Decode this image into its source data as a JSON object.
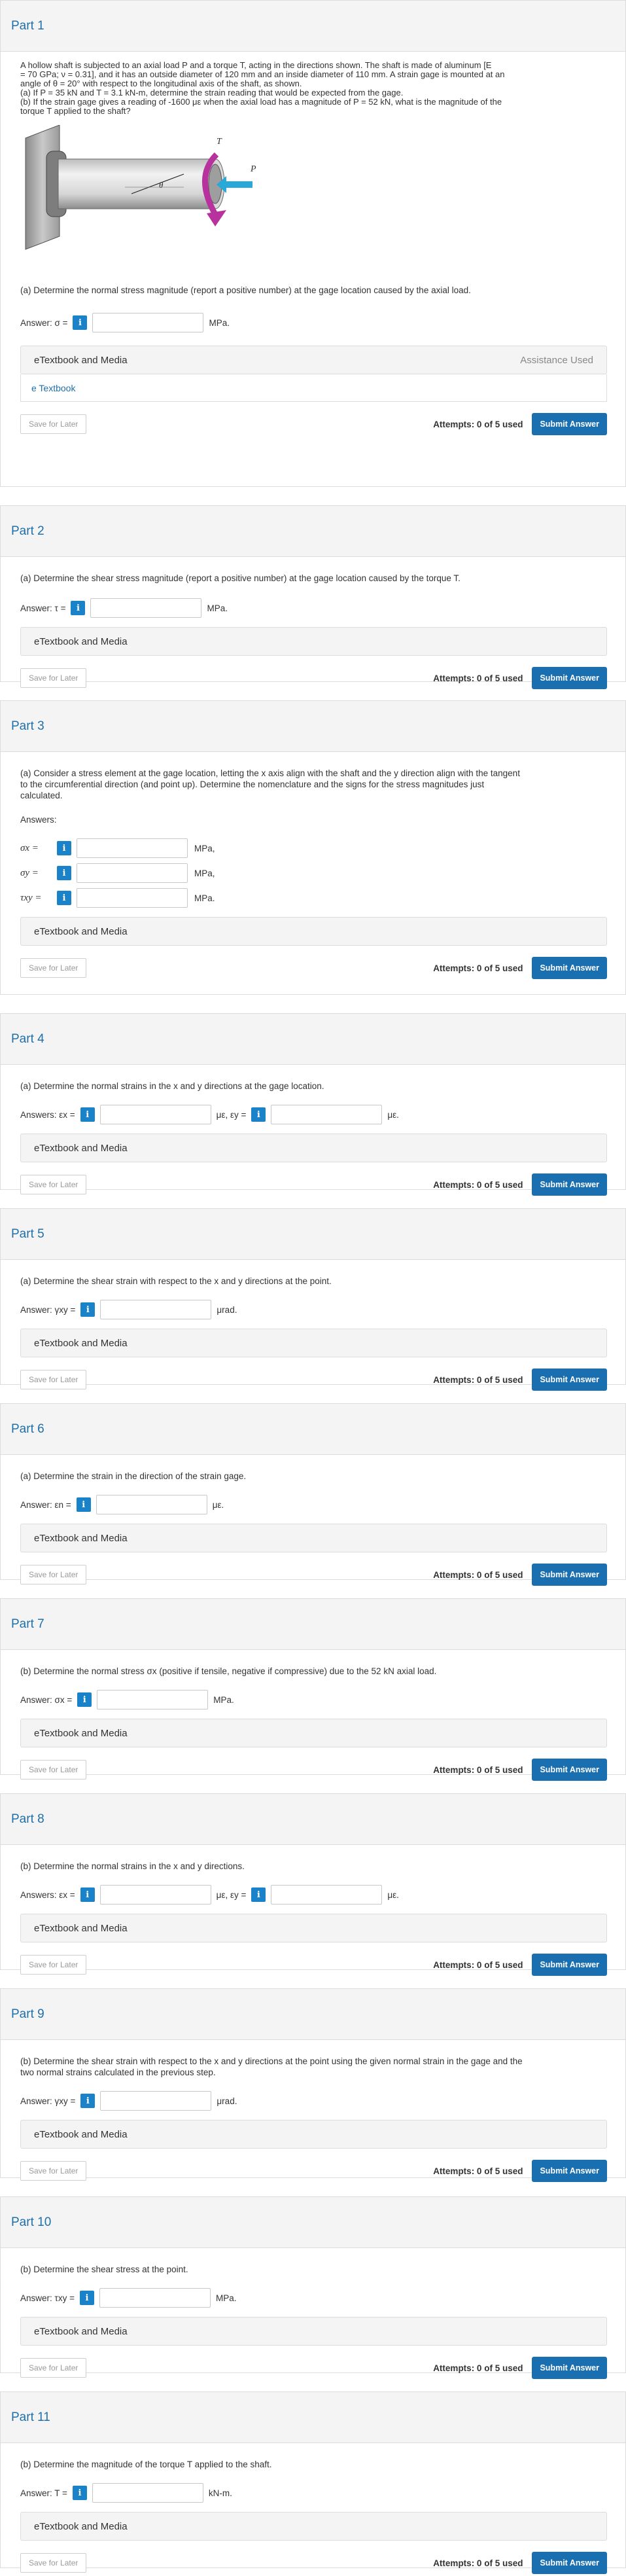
{
  "common": {
    "etextbook_label": "eTextbook and Media",
    "assistance_label": "Assistance Used",
    "etextbook_link": "e Textbook",
    "save_label": "Save for Later",
    "attempts_label": "Attempts: 0 of 5 used",
    "submit_label": "Submit Answer",
    "info_glyph": "i"
  },
  "colors": {
    "accent": "#1a82c8",
    "title": "#1f6fa8",
    "submit": "#1a6fb0"
  },
  "parts": [
    {
      "title": "Part 1",
      "intro": [
        "A hollow shaft is subjected to an axial load P and a torque T, acting in the directions shown. The shaft is made of aluminum [E",
        "= 70 GPa; ν = 0.31], and it has an outside diameter of 120 mm and an inside diameter of 110 mm. A strain gage is mounted at an",
        "angle of θ = 20° with respect to the longitudinal axis of the shaft, as shown.",
        "(a) If P = 35 kN and T = 3.1 kN-m, determine the strain reading that would be expected from the gage.",
        "(b) If the strain gage gives a reading of -1600 με when the axial load has a magnitude of P = 52 kN, what is the magnitude of the",
        "torque T applied to the shaft?"
      ],
      "figure_labels": {
        "T": "T",
        "P": "P",
        "theta": "θ"
      },
      "question": "(a) Determine the normal stress magnitude (report a positive number) at the gage location caused by the axial load.",
      "answer_label": "Answer: σ =",
      "unit": "MPa."
    },
    {
      "title": "Part 2",
      "question": "(a) Determine the shear stress magnitude (report a positive number) at the gage location caused by the torque T.",
      "answer_label": "Answer: τ =",
      "unit": "MPa."
    },
    {
      "title": "Part 3",
      "question_lines": [
        "(a) Consider a stress element at the gage location, letting the x axis align with the shaft and the y direction align with the tangent",
        "to the circumferential direction (and point up). Determine the nomenclature and the signs for the stress magnitudes just",
        "calculated."
      ],
      "answers_label": "Answers:",
      "rows": [
        {
          "label": "σx =",
          "unit": "MPa,"
        },
        {
          "label": "σy =",
          "unit": "MPa,"
        },
        {
          "label": "τxy =",
          "unit": "MPa."
        }
      ]
    },
    {
      "title": "Part 4",
      "question": "(a) Determine the normal strains in the x and y directions at the gage location.",
      "answer_label": "Answers: εx =",
      "mid_label": "με, εy =",
      "unit": "με."
    },
    {
      "title": "Part 5",
      "question": "(a) Determine the shear strain with respect to the x and y directions at the point.",
      "answer_label": "Answer: γxy =",
      "unit": "μrad."
    },
    {
      "title": "Part 6",
      "question": "(a) Determine the strain in the direction of the strain gage.",
      "answer_label": "Answer: εn =",
      "unit": "με."
    },
    {
      "title": "Part 7",
      "question": "(b) Determine the normal stress σx (positive if tensile, negative if compressive) due to the 52 kN axial load.",
      "answer_label": "Answer: σx =",
      "unit": "MPa."
    },
    {
      "title": "Part 8",
      "question": "(b) Determine the normal strains in the x and y directions.",
      "answer_label": "Answers: εx =",
      "mid_label": "με, εy =",
      "unit": "με."
    },
    {
      "title": "Part 9",
      "question_lines": [
        "(b) Determine the shear strain with respect to the x and y directions at the point using the given normal strain in the gage and the",
        "two normal strains calculated in the previous step."
      ],
      "answer_label": "Answer: γxy =",
      "unit": "μrad."
    },
    {
      "title": "Part 10",
      "question": "(b) Determine the shear stress at the point.",
      "answer_label": "Answer: τxy =",
      "unit": "MPa."
    },
    {
      "title": "Part 11",
      "question": "(b) Determine the magnitude of the torque T applied to the shaft.",
      "answer_label": "Answer: T =",
      "unit": "kN-m."
    }
  ]
}
